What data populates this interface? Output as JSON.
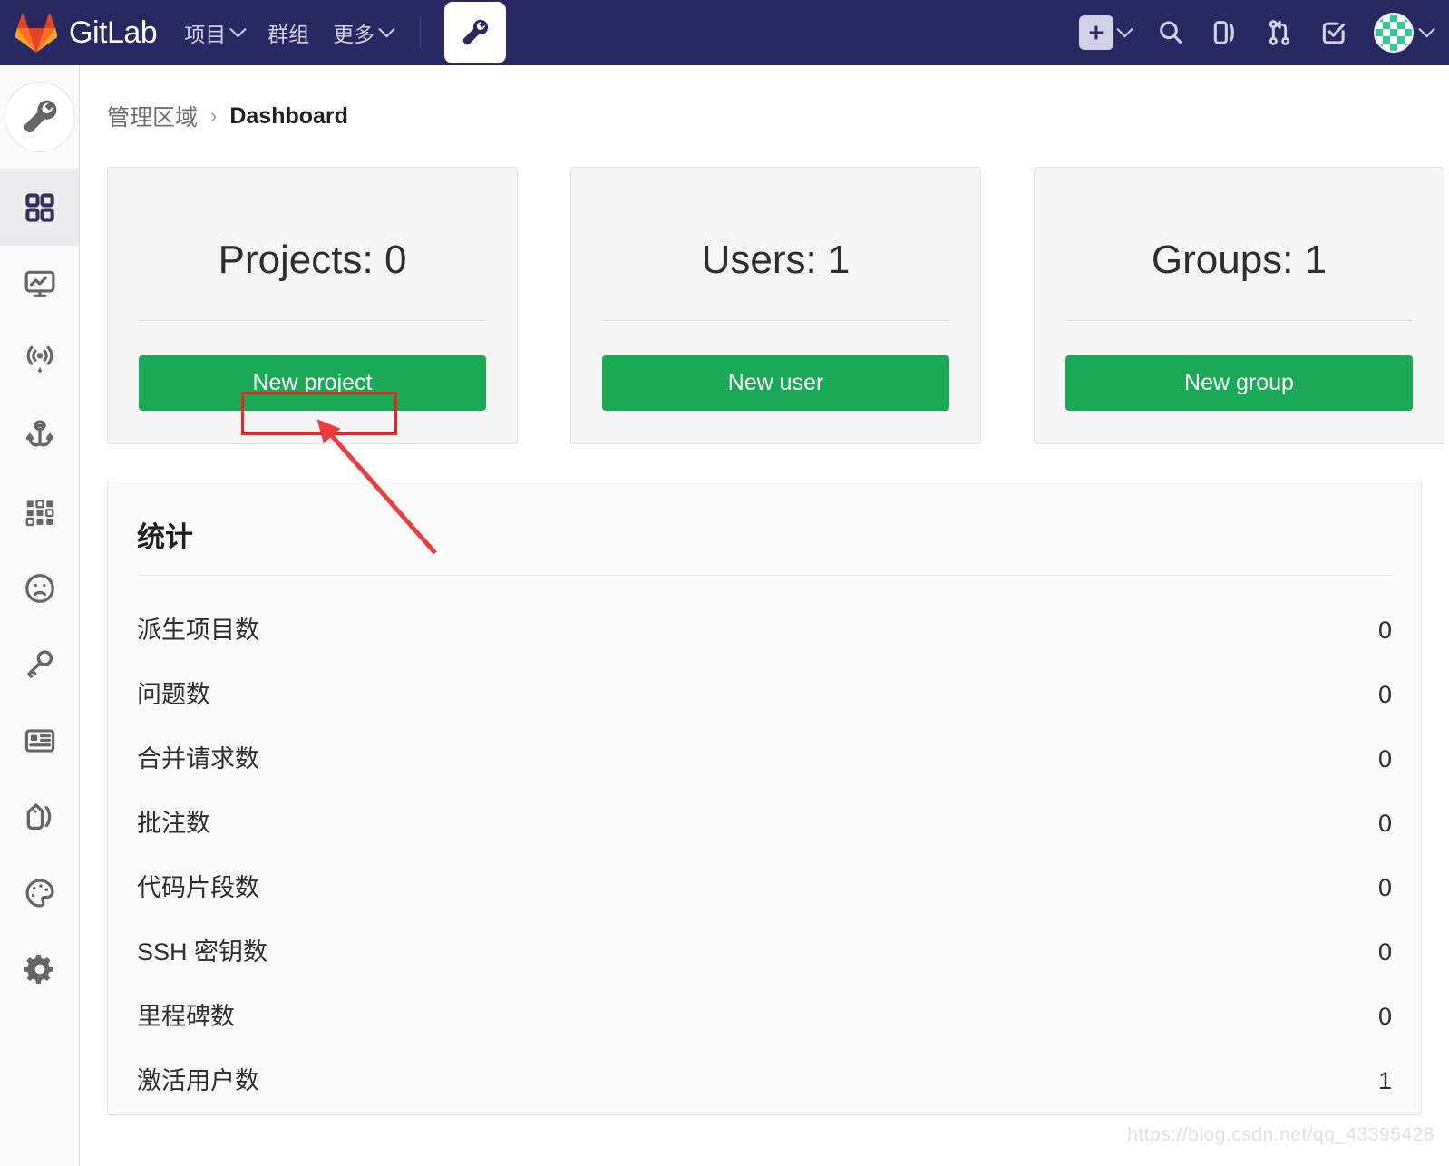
{
  "navbar": {
    "brand": "GitLab",
    "logo_icon": "gitlab-tanuki-logo",
    "menu": [
      {
        "label": "项目",
        "has_chevron": true
      },
      {
        "label": "群组",
        "has_chevron": false
      },
      {
        "label": "更多",
        "has_chevron": true
      }
    ],
    "admin_button_icon": "wrench-icon",
    "right_icons": [
      {
        "name": "plus-icon",
        "has_chevron": true
      },
      {
        "name": "search-icon",
        "has_chevron": false
      },
      {
        "name": "issues-icon",
        "has_chevron": false
      },
      {
        "name": "merge-requests-icon",
        "has_chevron": false
      },
      {
        "name": "todos-icon",
        "has_chevron": false
      }
    ],
    "avatar_icon": "user-identicon-avatar",
    "background_color": "#292961"
  },
  "sidebar": {
    "header_icon": "wrench-icon",
    "items": [
      {
        "icon": "overview-grid-icon",
        "active": true
      },
      {
        "icon": "monitoring-icon",
        "active": false
      },
      {
        "icon": "system-hooks-broadcast-icon",
        "active": false
      },
      {
        "icon": "deploy-keys-anchor-icon",
        "active": false
      },
      {
        "icon": "applications-dots-icon",
        "active": false
      },
      {
        "icon": "abuse-reports-frown-icon",
        "active": false
      },
      {
        "icon": "key-icon",
        "active": false
      },
      {
        "icon": "license-card-icon",
        "active": false
      },
      {
        "icon": "labels-tag-icon",
        "active": false
      },
      {
        "icon": "appearance-palette-icon",
        "active": false
      },
      {
        "icon": "settings-gear-icon",
        "active": false
      }
    ],
    "active_background": "#ececef"
  },
  "breadcrumb": {
    "parent": "管理区域",
    "separator": "›",
    "current": "Dashboard"
  },
  "cards": [
    {
      "title": "Projects: 0",
      "button_label": "New project",
      "count": 0,
      "entity": "Projects"
    },
    {
      "title": "Users: 1",
      "button_label": "New user",
      "count": 1,
      "entity": "Users"
    },
    {
      "title": "Groups: 1",
      "button_label": "New group",
      "count": 1,
      "entity": "Groups"
    }
  ],
  "statistics": {
    "heading": "统计",
    "rows": [
      {
        "label": "派生项目数",
        "value": "0"
      },
      {
        "label": "问题数",
        "value": "0"
      },
      {
        "label": "合并请求数",
        "value": "0"
      },
      {
        "label": "批注数",
        "value": "0"
      },
      {
        "label": "代码片段数",
        "value": "0"
      },
      {
        "label": "SSH 密钥数",
        "value": "0"
      },
      {
        "label": "里程碑数",
        "value": "0"
      },
      {
        "label": "激活用户数",
        "value": "1"
      }
    ]
  },
  "annotation": {
    "highlight_target": "New project",
    "color": "#fa1e1e"
  },
  "watermark": {
    "text": "https://blog.csdn.net/qq_43395428"
  },
  "colors": {
    "navbar": "#292961",
    "primary_green": "#1aaa55",
    "annotation_red": "#fa1e1e",
    "card_bg": "#f5f5f5"
  }
}
